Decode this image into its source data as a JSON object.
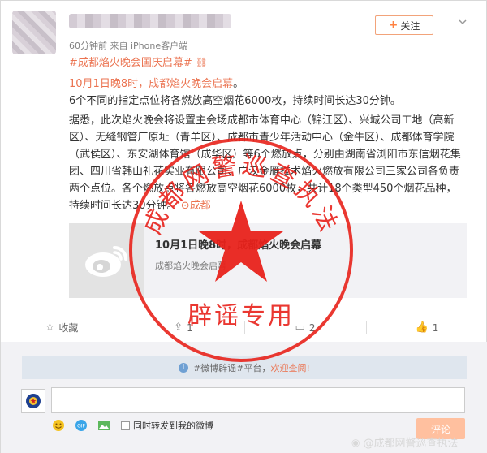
{
  "post": {
    "meta": "60分钟前 来自 iPhone客户端",
    "follow_label": "关注",
    "hashtag": "#成都焰火晚会国庆启幕#",
    "headline": "10月1日晚8时，成都焰火晚会启幕",
    "headline_end": "。",
    "body_line1": "6个不同的指定点位将各燃放高空烟花6000枚，持续时间长达30分钟。",
    "body_paragraph": "据悉，此次焰火晚会将设置主会场成都市体育中心（锦江区）、兴城公司工地（高新区）、无缝钢管厂原址（青羊区）、成都市青少年活动中心（金牛区）、成都体育学院（武侯区）、东安湖体育馆（成华区）等6个燃放点，分别由湖南省浏阳市东信烟花集团、四川省韩山礼花实业有限公司、广汉金雁技术焰火燃放有限公司三家公司各负责两个点位。各个燃放点将各燃放高空烟花6000枚，共计18个类型450个烟花品种，持续时间长达30分钟。",
    "location": "成都",
    "shared": {
      "title": "10月1日晚8时，成都焰火晚会启幕",
      "subtitle": "成都焰火晚会启幕"
    }
  },
  "actions": [
    {
      "icon": "star-icon",
      "label": "收藏"
    },
    {
      "icon": "share-icon",
      "label": "1"
    },
    {
      "icon": "comment-icon",
      "label": "2"
    },
    {
      "icon": "like-icon",
      "label": "1"
    }
  ],
  "comment": {
    "notice_prefix": "#微博辟谣#平台，",
    "notice_link": "欢迎查阅!",
    "forward_label": "同时转发到我的微博",
    "submit_label": "评论"
  },
  "seal": {
    "arc_text": "成都网警巡查执法",
    "bottom_text": "辟谣专用",
    "color": "#e8221b"
  },
  "watermark": "@成都网警巡查执法"
}
